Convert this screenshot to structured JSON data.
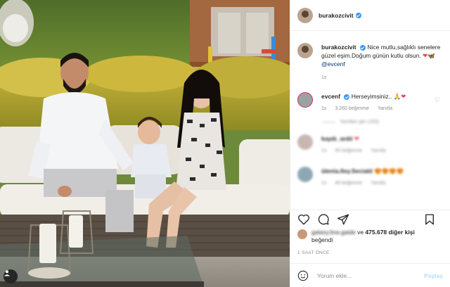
{
  "post": {
    "author": "burakozcivit",
    "verified": true,
    "caption_text": "Nice mutlu,sağlıklı senelere güzel eşim.Doğum günün kutlu olsun.",
    "caption_emojis": [
      "❤",
      "🦋"
    ],
    "caption_mention": "@evcenf",
    "caption_time": "1s"
  },
  "comments": [
    {
      "author": "evcenf",
      "verified": true,
      "text": "Herseyimsiniz..",
      "emojis": [
        "🙏",
        "❤"
      ],
      "time": "1s",
      "likes": "3.260 beğenme",
      "reply": "Yanıtla",
      "view_replies": "Yanıtları gör (153)"
    },
    {
      "author": "kaydı_ardıl",
      "text": "❤",
      "time": "1s",
      "likes": "45 beğenme",
      "reply": "Yanıtla"
    },
    {
      "author": "ülenia.lley.Seciald",
      "text": "😍😍😍😍",
      "time": "1s",
      "likes": "46 beğenme",
      "reply": "Yanıtla"
    }
  ],
  "likes_summary": {
    "liked_by": "galaxy.lina.gaide",
    "others_prefix": "ve",
    "others_count": "475.678 diğer kişi",
    "suffix": "beğendi"
  },
  "timestamp": "1 SAAT ÖNCE",
  "comment_input": {
    "placeholder": "Yorum ekle...",
    "post_label": "Paylaş"
  },
  "icons": {
    "like": "heart-icon",
    "comment": "comment-bubble-icon",
    "share": "send-icon",
    "save": "bookmark-icon",
    "emoji": "emoji-smile-icon",
    "tagged_users": "user-tag-icon"
  },
  "colors": {
    "verified": "#3897f0",
    "link": "#00376b",
    "muted": "#8e8e8e",
    "post_button_disabled": "#b2dffc",
    "heart": "#ed4956"
  }
}
